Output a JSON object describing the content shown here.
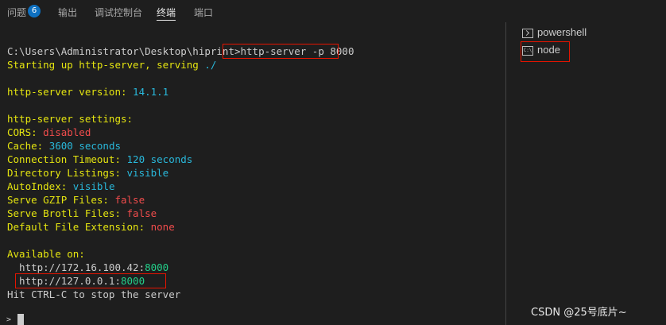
{
  "tabs": {
    "problems": "问题",
    "problems_count": "6",
    "output": "输出",
    "debug_console": "调试控制台",
    "terminal": "终端",
    "ports": "端口"
  },
  "terminal": {
    "prompt": "C:\\Users\\Administrator\\Desktop\\hiprint>",
    "command": "http-server -p 8000",
    "starting_prefix": "Starting up http-server, serving ",
    "starting_path": "./",
    "version_label": "http-server version: ",
    "version_value": "14.1.1",
    "settings_header": "http-server settings:",
    "settings": [
      {
        "label": "CORS: ",
        "value": "disabled"
      },
      {
        "label": "Cache: ",
        "value": "3600 seconds"
      },
      {
        "label": "Connection Timeout: ",
        "value": "120 seconds"
      },
      {
        "label": "Directory Listings: ",
        "value": "visible"
      },
      {
        "label": "AutoIndex: ",
        "value": "visible"
      },
      {
        "label": "Serve GZIP Files: ",
        "value": "false"
      },
      {
        "label": "Serve Brotli Files: ",
        "value": "false"
      },
      {
        "label": "Default File Extension: ",
        "value": "none"
      }
    ],
    "available_on": "Available on:",
    "addresses": [
      {
        "host": "  http://172.16.100.42:",
        "port": "8000"
      },
      {
        "host": "  http://127.0.0.1:",
        "port": "8000"
      }
    ],
    "stop_hint": "Hit CTRL-C to stop the server",
    "cursor_prompt": ">"
  },
  "terminals": [
    {
      "name": "powershell",
      "icon": "powershell-icon"
    },
    {
      "name": "node",
      "icon": "cmd-icon",
      "icon_text": "C:\\"
    }
  ],
  "watermark": "CSDN @25号底片~",
  "colors": {
    "background": "#1e1e1e",
    "yellow": "#e5e510",
    "blue": "#29b8db",
    "red": "#f14c4c",
    "green": "#23d18b",
    "highlight_box": "#e51400"
  }
}
